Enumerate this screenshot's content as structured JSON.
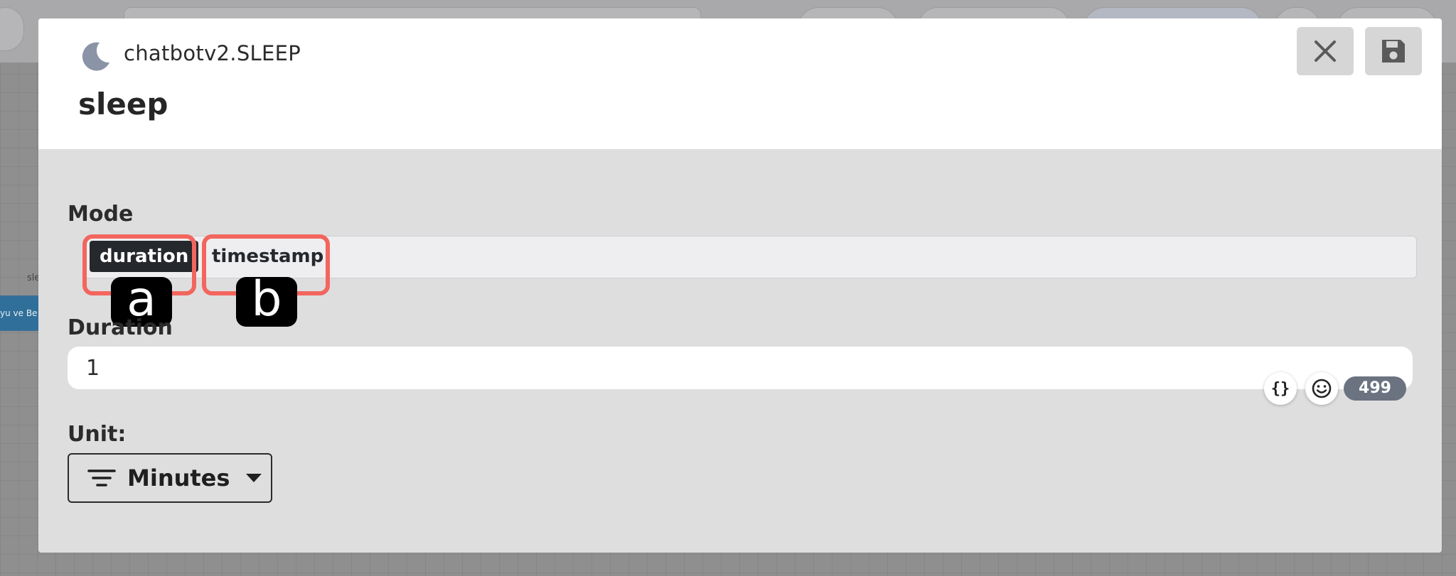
{
  "background": {
    "canvas_label": "sle",
    "node_label": "yu ve Be"
  },
  "modal": {
    "subtitle": "chatbotv2.SLEEP",
    "title": "sleep",
    "icon": "moon-icon",
    "close_icon": "close-icon",
    "save_icon": "save-icon"
  },
  "mode": {
    "label": "Mode",
    "options": [
      {
        "label": "duration",
        "active": true,
        "marker": "a"
      },
      {
        "label": "timestamp",
        "active": false,
        "marker": "b"
      }
    ]
  },
  "duration": {
    "label": "Duration",
    "value": "1",
    "char_count": "499",
    "variable_icon": "curly-braces-icon",
    "emoji_icon": "smiley-icon"
  },
  "unit": {
    "label": "Unit:",
    "selected": "Minutes",
    "icon": "filter-lines-icon"
  },
  "colors": {
    "marker_outline": "#f2665e",
    "active_chip": "#25282c",
    "badge": "#6b7280"
  }
}
